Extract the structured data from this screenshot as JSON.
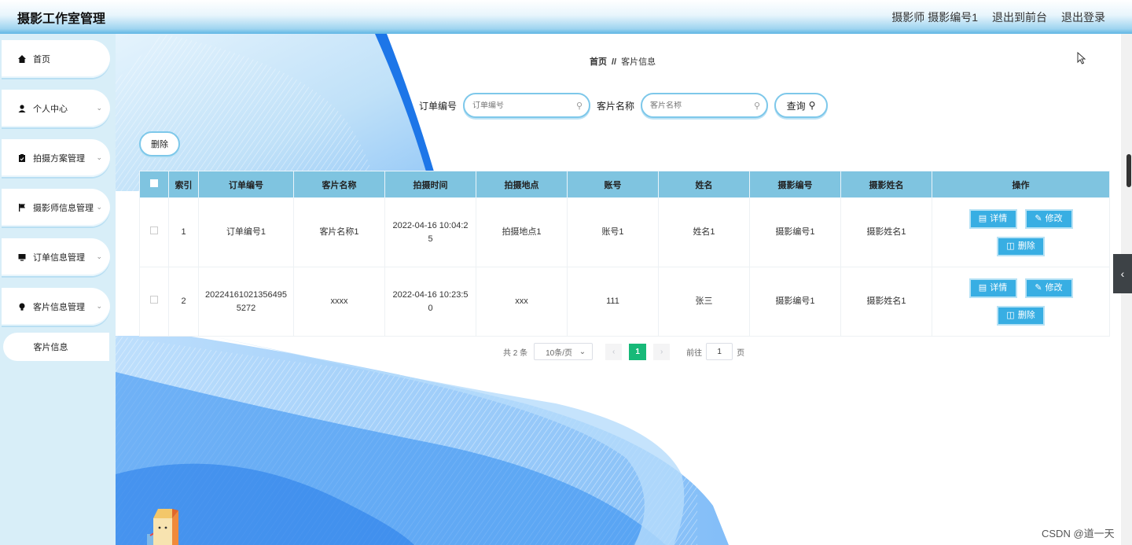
{
  "header": {
    "brand": "摄影工作室管理",
    "user": "摄影师 摄影编号1",
    "to_front": "退出到前台",
    "logout": "退出登录"
  },
  "sidebar": {
    "items": [
      {
        "label": "首页",
        "icon": "home-icon"
      },
      {
        "label": "个人中心",
        "icon": "user-icon"
      },
      {
        "label": "拍摄方案管理",
        "icon": "clipboard-icon"
      },
      {
        "label": "摄影师信息管理",
        "icon": "flag-icon"
      },
      {
        "label": "订单信息管理",
        "icon": "monitor-icon"
      },
      {
        "label": "客片信息管理",
        "icon": "lightbulb-icon"
      }
    ],
    "sub_item": "客片信息"
  },
  "breadcrumb": {
    "home": "首页",
    "sep": "//",
    "current": "客片信息"
  },
  "search": {
    "order_label": "订单编号",
    "order_placeholder": "订单编号",
    "name_label": "客片名称",
    "name_placeholder": "客片名称",
    "query_label": "查询"
  },
  "delete_label": "删除",
  "table": {
    "headers": [
      "索引",
      "订单编号",
      "客片名称",
      "拍摄时间",
      "拍摄地点",
      "账号",
      "姓名",
      "摄影编号",
      "摄影姓名",
      "操作"
    ],
    "rows": [
      {
        "index": "1",
        "order": "订单编号1",
        "name": "客片名称1",
        "time": "2022-04-16 10:04:25",
        "place": "拍摄地点1",
        "account": "账号1",
        "person": "姓名1",
        "photog_id": "摄影编号1",
        "photog_name": "摄影姓名1"
      },
      {
        "index": "2",
        "order": "202241610213564955272",
        "name": "xxxx",
        "time": "2022-04-16 10:23:50",
        "place": "xxx",
        "account": "111",
        "person": "张三",
        "photog_id": "摄影编号1",
        "photog_name": "摄影姓名1"
      }
    ],
    "actions": {
      "detail": "详情",
      "edit": "修改",
      "delete": "删除"
    }
  },
  "pager": {
    "total": "共 2 条",
    "page_size": "10条/页",
    "current_page": "1",
    "goto_label": "前往",
    "goto_value": "1",
    "page_suffix": "页"
  },
  "watermark": "CSDN @道一天",
  "colors": {
    "header_accent": "#5fb6e4",
    "table_header": "#7fc4e0",
    "action_button": "#38aee3",
    "active_page": "#17b978",
    "sidebar_bg": "#d8eef8"
  }
}
